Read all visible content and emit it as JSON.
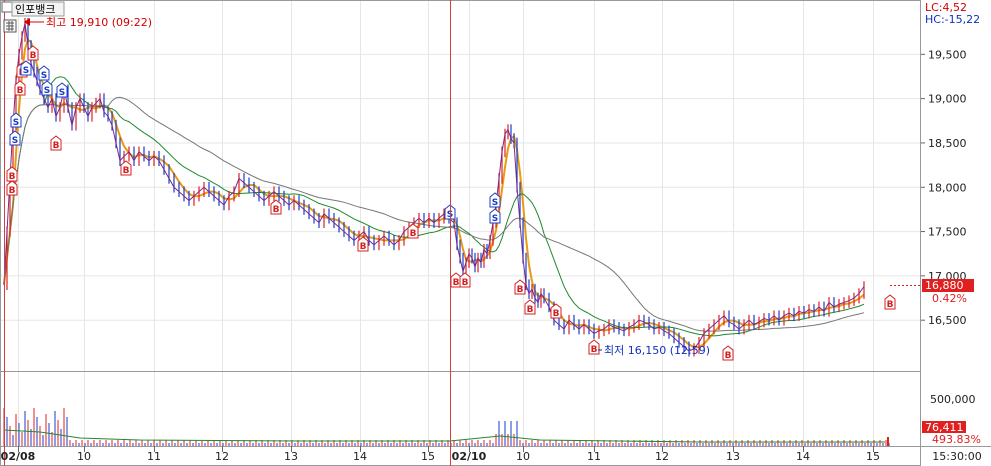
{
  "title": "인포뱅크",
  "info": {
    "lc": "LC:4,52",
    "hc": "HC:-15,22"
  },
  "chart_data": {
    "type": "line",
    "title": "인포뱅크",
    "price_ticks": [
      "19,500",
      "19,000",
      "18,500",
      "18,000",
      "17,500",
      "17,000",
      "16,500"
    ],
    "price_range": [
      16000,
      20000
    ],
    "volume_ticks": [
      "500,000"
    ],
    "x_labels": [
      "02/08",
      "10",
      "11",
      "12",
      "13",
      "14",
      "15",
      "02/10",
      "10",
      "11",
      "12",
      "13",
      "14",
      "15",
      "15:30:00"
    ],
    "high_annotation": "최고 19,910 (09:22)",
    "low_annotation": "최저 16,150 (12:59)",
    "current_price": "16,880",
    "current_change": "0.42%",
    "current_volume": "76,411",
    "volume_ratio": "493.83%",
    "price_series": {
      "x": [
        0,
        3,
        6,
        9,
        12,
        15,
        18,
        21,
        24,
        27,
        30,
        33,
        36,
        40,
        44,
        48,
        52,
        56,
        60,
        64,
        68,
        72,
        76,
        80,
        84,
        88,
        92,
        96,
        100,
        104,
        108,
        112,
        116,
        120,
        125,
        130,
        135,
        140,
        145,
        150,
        155,
        160,
        165,
        170,
        175,
        180,
        185,
        190,
        195,
        200,
        205,
        210,
        215,
        220,
        225,
        230,
        235,
        240,
        245,
        250,
        255,
        260,
        265,
        270,
        275,
        280,
        285,
        290,
        295,
        300,
        305,
        310,
        315,
        320,
        325,
        330,
        335,
        340,
        345,
        350,
        355,
        360,
        365,
        370,
        375,
        380,
        385,
        390,
        395,
        400,
        405,
        410,
        415,
        420,
        425,
        430,
        435,
        440,
        445,
        450,
        453,
        456,
        459,
        462,
        465,
        468,
        471,
        474,
        477,
        480,
        483,
        486,
        489,
        492,
        495,
        498,
        501,
        504,
        507,
        510,
        513,
        516,
        519,
        522,
        525,
        528,
        531,
        534,
        537,
        540,
        545,
        550,
        555,
        560,
        565,
        570,
        575,
        580,
        585,
        590,
        595,
        600,
        605,
        610,
        615,
        620,
        625,
        630,
        635,
        640,
        645,
        650,
        655,
        660,
        665,
        670,
        675,
        680,
        685,
        690,
        695,
        700,
        705,
        710,
        715,
        720,
        725,
        730,
        735,
        740,
        745,
        750,
        755,
        760,
        765,
        770,
        775,
        780,
        785,
        790,
        795,
        800,
        805,
        810,
        815,
        820,
        825,
        830,
        835,
        840,
        845,
        850,
        855,
        860,
        865,
        870,
        875,
        880,
        885,
        890
      ],
      "y": [
        16900,
        17500,
        18100,
        18700,
        19200,
        19500,
        19700,
        19850,
        19600,
        19400,
        19300,
        19200,
        19100,
        19000,
        18900,
        19000,
        18800,
        18900,
        19100,
        18900,
        18700,
        18900,
        19000,
        18900,
        18800,
        18900,
        18950,
        19000,
        18850,
        18800,
        18700,
        18500,
        18300,
        18350,
        18400,
        18300,
        18400,
        18350,
        18300,
        18350,
        18300,
        18200,
        18100,
        18000,
        17950,
        17900,
        17850,
        17900,
        17950,
        18000,
        17950,
        17900,
        17850,
        17800,
        17900,
        17950,
        18100,
        18050,
        18000,
        17950,
        17900,
        17850,
        17900,
        17950,
        17900,
        17850,
        17800,
        17850,
        17800,
        17750,
        17700,
        17650,
        17600,
        17700,
        17650,
        17600,
        17550,
        17500,
        17450,
        17400,
        17450,
        17500,
        17400,
        17350,
        17400,
        17450,
        17400,
        17350,
        17400,
        17500,
        17550,
        17600,
        17650,
        17600,
        17650,
        17600,
        17650,
        17700,
        17650,
        17600,
        17350,
        17200,
        17050,
        17150,
        17250,
        17200,
        17100,
        17200,
        17150,
        17300,
        17250,
        17400,
        17600,
        17800,
        18100,
        18400,
        18600,
        18650,
        18550,
        18500,
        18000,
        17600,
        17200,
        16900,
        16800,
        16850,
        16750,
        16700,
        16800,
        16750,
        16650,
        16500,
        16450,
        16400,
        16500,
        16450,
        16400,
        16450,
        16400,
        16350,
        16380,
        16400,
        16450,
        16420,
        16400,
        16380,
        16420,
        16450,
        16500,
        16480,
        16450,
        16400,
        16420,
        16380,
        16350,
        16300,
        16250,
        16200,
        16150,
        16180,
        16250,
        16350,
        16400,
        16450,
        16500,
        16550,
        16480,
        16450,
        16400,
        16450,
        16500,
        16450,
        16480,
        16520,
        16500,
        16550,
        16500,
        16550,
        16580,
        16550,
        16600,
        16580,
        16620,
        16600,
        16650,
        16600,
        16700,
        16650,
        16680,
        16700,
        16720,
        16750,
        16800,
        16880
      ]
    }
  }
}
